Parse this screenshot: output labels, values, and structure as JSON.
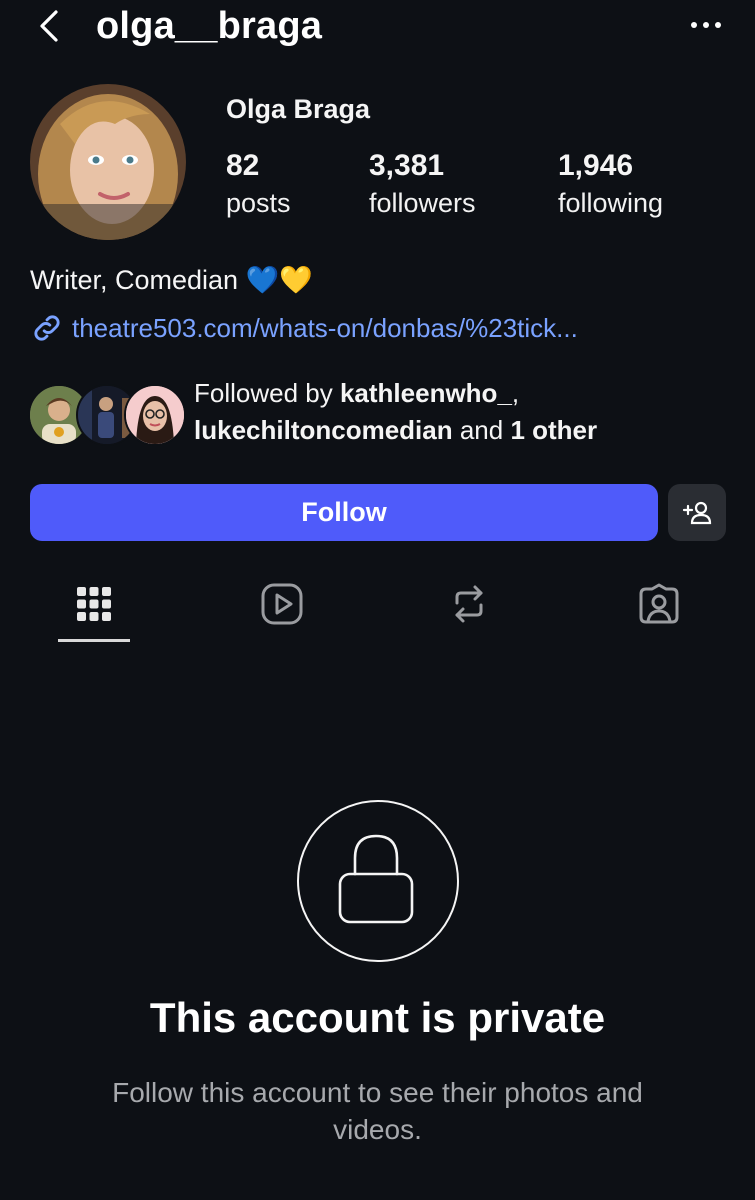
{
  "header": {
    "username": "olga__braga",
    "back_icon": "chevron-left-icon",
    "more_icon": "more-horizontal-icon"
  },
  "profile": {
    "display_name": "Olga Braga",
    "stats": [
      {
        "value": "82",
        "label": "posts"
      },
      {
        "value": "3,381",
        "label": "followers"
      },
      {
        "value": "1,946",
        "label": "following"
      }
    ],
    "bio": "Writer, Comedian 💙💛",
    "link": "theatre503.com/whats-on/donbas/%23tick..."
  },
  "followed_by": {
    "prefix": "Followed by ",
    "user1": "kathleenwho_",
    "separator": ",",
    "user2": "lukechiltoncomedian",
    "connector": " and ",
    "others": "1 other"
  },
  "actions": {
    "follow_label": "Follow",
    "suggest_icon": "add-person-icon"
  },
  "tabs": [
    {
      "name": "posts",
      "icon": "grid-icon",
      "active": true
    },
    {
      "name": "reels",
      "icon": "play-icon",
      "active": false
    },
    {
      "name": "reposts",
      "icon": "repost-icon",
      "active": false
    },
    {
      "name": "tagged",
      "icon": "tagged-person-icon",
      "active": false
    }
  ],
  "private": {
    "title": "This account is private",
    "subtitle": "Follow this account to see their photos and videos."
  },
  "colors": {
    "background": "#0d1015",
    "accent": "#4f5bfa",
    "link": "#7aa2ff"
  }
}
